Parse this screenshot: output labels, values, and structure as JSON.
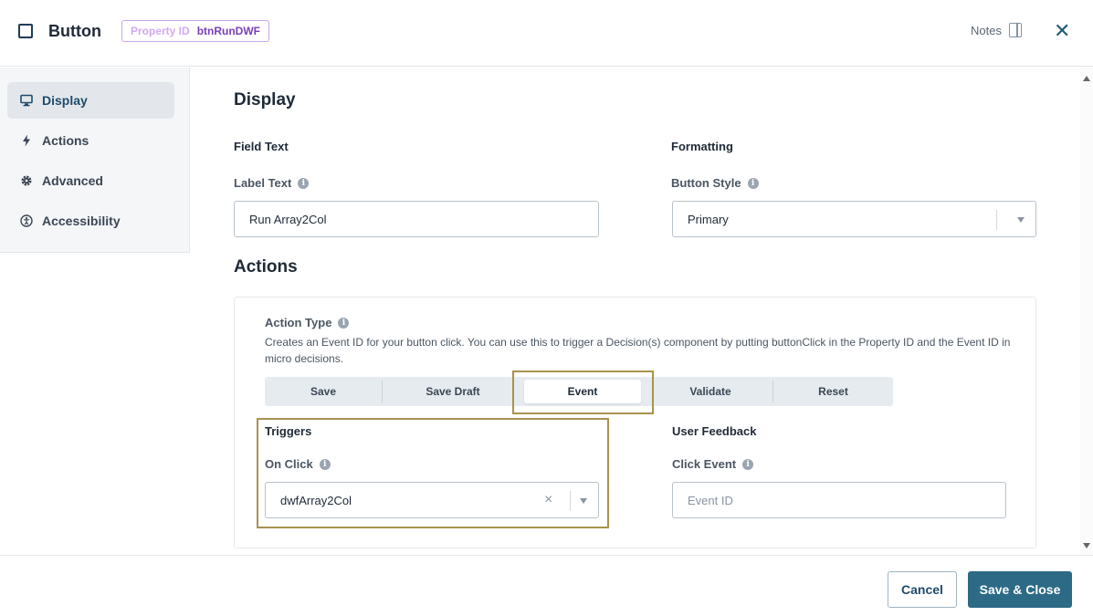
{
  "header": {
    "title": "Button",
    "property_id_label": "Property ID",
    "property_id_value": "btnRunDWF",
    "notes_label": "Notes",
    "close_glyph": "✕"
  },
  "sidebar": {
    "items": [
      {
        "label": "Display",
        "icon": "monitor-icon",
        "active": true
      },
      {
        "label": "Actions",
        "icon": "lightning-icon",
        "active": false
      },
      {
        "label": "Advanced",
        "icon": "gear-icon",
        "active": false
      },
      {
        "label": "Accessibility",
        "icon": "accessibility-icon",
        "active": false
      }
    ]
  },
  "display": {
    "heading": "Display",
    "field_text_heading": "Field Text",
    "label_text_label": "Label Text",
    "label_text_value": "Run Array2Col",
    "formatting_heading": "Formatting",
    "button_style_label": "Button Style",
    "button_style_value": "Primary"
  },
  "actions": {
    "heading": "Actions",
    "action_type_label": "Action Type",
    "description": "Creates an Event ID for your button click. You can use this to trigger a Decision(s) component by putting buttonClick in the Property ID and the Event ID in micro decisions.",
    "types": [
      "Save",
      "Save Draft",
      "Event",
      "Validate",
      "Reset"
    ],
    "selected_type": "Event",
    "triggers_heading": "Triggers",
    "on_click_label": "On Click",
    "on_click_value": "dwfArray2Col",
    "clear_glyph": "×",
    "user_feedback_heading": "User Feedback",
    "click_event_label": "Click Event",
    "click_event_placeholder": "Event ID"
  },
  "footer": {
    "cancel_label": "Cancel",
    "save_close_label": "Save & Close"
  },
  "colors": {
    "primary": "#2d6a86",
    "highlight": "#a8924e",
    "badge_value": "#7a3fb8"
  }
}
